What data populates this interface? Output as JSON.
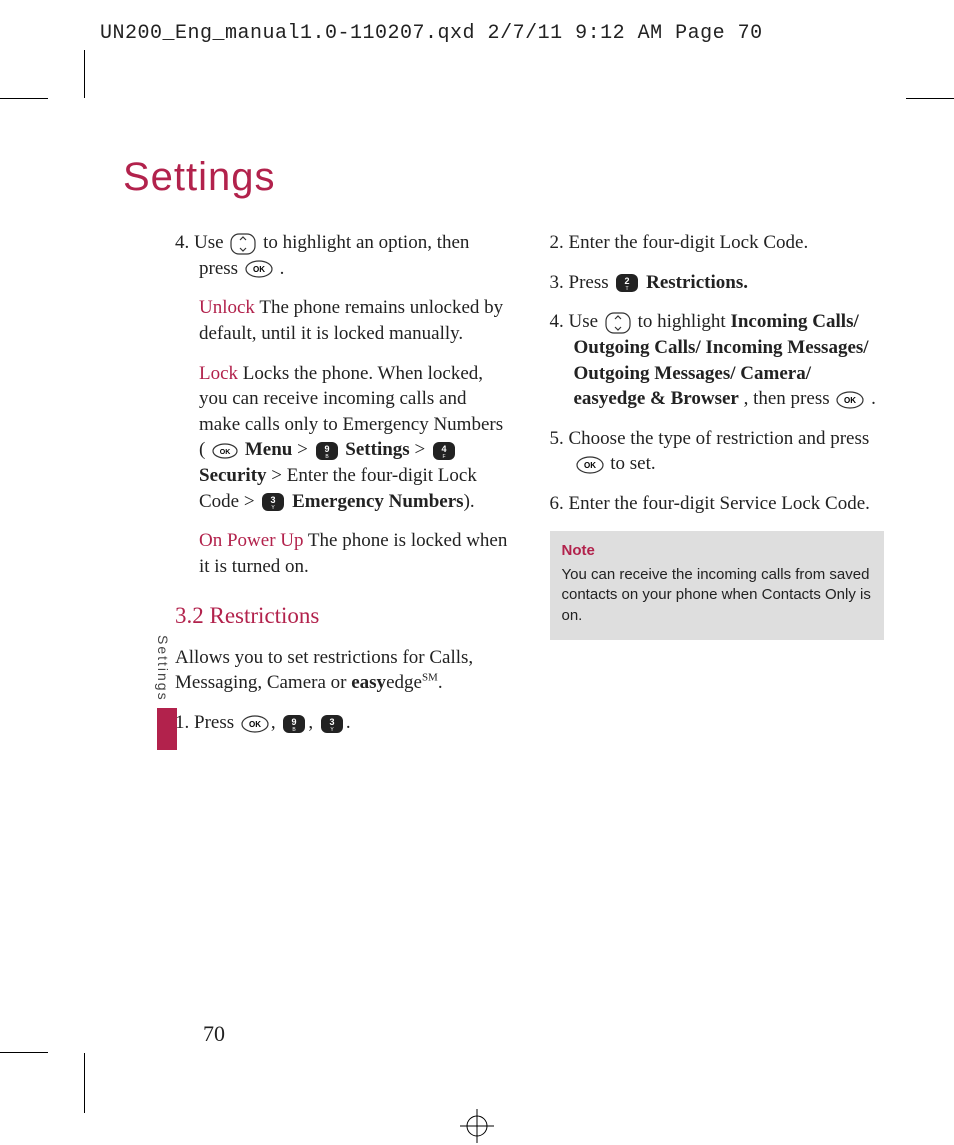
{
  "header": "UN200_Eng_manual1.0-110207.qxd  2/7/11  9:12 AM  Page 70",
  "title": "Settings",
  "side_label": "Settings",
  "page_number": "70",
  "left": {
    "s4a": "4. Use ",
    "s4b": " to highlight an option, then press ",
    "s4c": " .",
    "unlock_t": "Unlock",
    "unlock_b": " The phone remains unlocked by default, until it is locked manually.",
    "lock_t": "Lock",
    "lock_b1": " Locks the phone. When locked, you can receive incoming calls and make calls only to Emergency Numbers ( ",
    "menu": " Menu",
    "gt1": " > ",
    "settings": " Settings",
    "gt2": " > ",
    "security": " Security",
    "lock_b2": " > Enter the four-digit Lock Code > ",
    "emerg": " Emergency Numbers",
    "lock_b3": ").",
    "power_t": "On Power Up",
    "power_b": " The phone is locked when it is turned on.",
    "restr_h": "3.2 Restrictions",
    "restr_intro_a": "Allows you to set restrictions for Calls, Messaging, Camera or ",
    "restr_intro_easy": "easy",
    "restr_intro_edge": "edge",
    "restr_intro_sm": "SM",
    "restr_intro_b": ".",
    "s1a": "1. Press ",
    "comma": ",  ",
    "period": "."
  },
  "right": {
    "s2": "2. Enter the four-digit Lock Code.",
    "s3a": "3. Press ",
    "s3b": "Restrictions.",
    "s4a": "4. Use ",
    "s4b": " to highlight ",
    "s4c": "Incoming Calls/ Outgoing Calls/ Incoming Messages/ Outgoing Messages/ Camera/ easyedge & Browser",
    "s4d": ", then press ",
    "s4e": " .",
    "s5a": "5. Choose the type of restriction and press ",
    "s5b": " to set.",
    "s6": "6. Enter the four-digit Service Lock Code.",
    "note_t": "Note",
    "note_b": "You can receive the incoming calls from saved contacts on your phone when Contacts Only is on."
  },
  "keys": {
    "k9": "9",
    "k9s": "B",
    "k4": "4",
    "k4s": "F",
    "k3": "3",
    "k3s": "Y",
    "k2": "2",
    "k2s": "T"
  }
}
